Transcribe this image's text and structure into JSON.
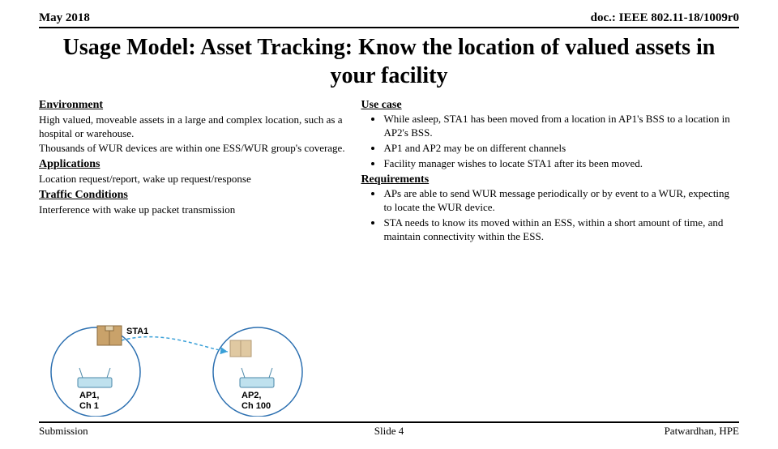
{
  "header": {
    "date": "May 2018",
    "doc": "doc.: IEEE 802.11-18/1009r0"
  },
  "title": "Usage Model: Asset Tracking: Know the location of valued assets in your facility",
  "left": {
    "env_h": "Environment",
    "env_p1": "High valued, moveable assets in a large and complex location, such as a hospital or warehouse.",
    "env_p2": "Thousands of WUR devices are within one ESS/WUR group's coverage.",
    "app_h": "Applications",
    "app_p": "Location request/report, wake up request/response",
    "traf_h": "Traffic Conditions",
    "traf_p": "Interference with wake up packet transmission"
  },
  "right": {
    "use_h": "Use case",
    "use_b1": "While asleep, STA1 has been moved from a location in AP1's BSS to a location in AP2's BSS.",
    "use_b2": "AP1 and AP2 may be on different channels",
    "use_b3": "Facility manager wishes to locate STA1 after its been moved.",
    "req_h": "Requirements",
    "req_b1": "APs are able to send WUR message periodically or by event to a WUR, expecting to locate the WUR device.",
    "req_b2": "STA needs to know its moved within an ESS, within a short amount of time, and maintain connectivity within the ESS."
  },
  "diagram": {
    "sta1": "STA1",
    "ap1_l1": "AP1,",
    "ap1_l2": "Ch 1",
    "ap2_l1": "AP2,",
    "ap2_l2": "Ch 100"
  },
  "footer": {
    "left": "Submission",
    "center": "Slide 4",
    "right": "Patwardhan, HPE"
  }
}
